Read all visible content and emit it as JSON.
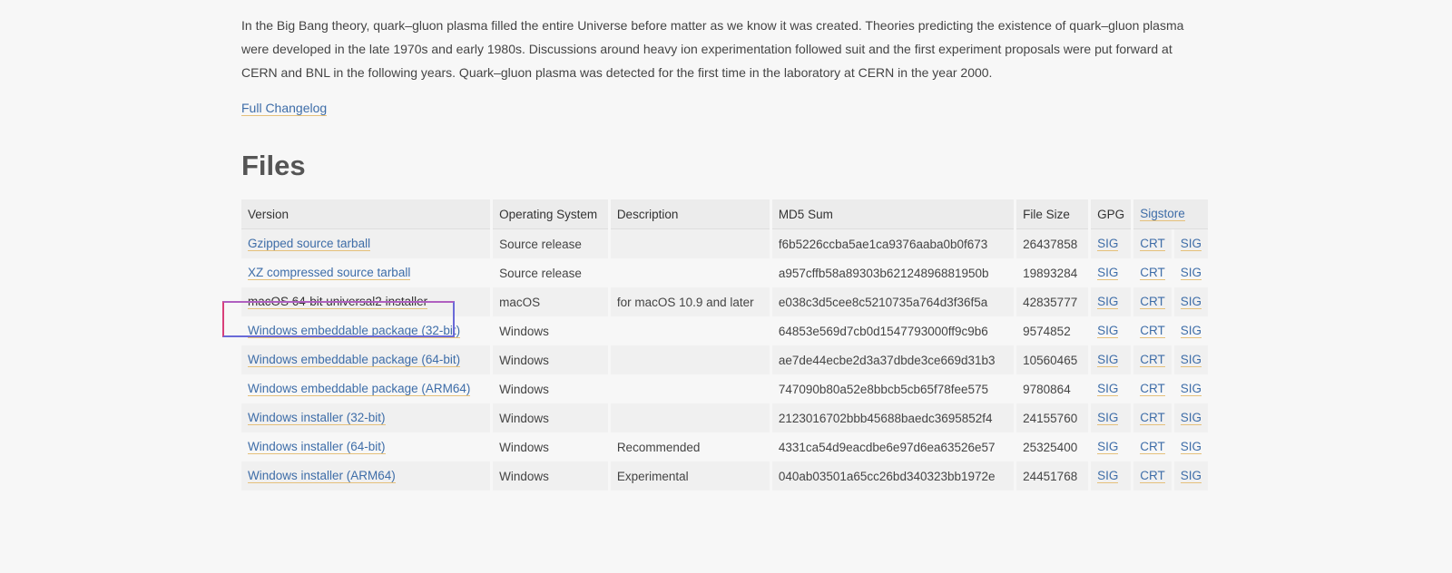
{
  "intro_text": "In the Big Bang theory, quark–gluon plasma filled the entire Universe before matter as we know it was created. Theories predicting the existence of quark–gluon plasma were developed in the late 1970s and early 1980s. Discussions around heavy ion experimentation followed suit and the first experiment proposals were put forward at CERN and BNL in the following years. Quark–gluon plasma was detected for the first time in the laboratory at CERN in the year 2000.",
  "changelog_label": "Full Changelog",
  "files_title": "Files",
  "columns": {
    "version": "Version",
    "os": "Operating System",
    "description": "Description",
    "md5": "MD5 Sum",
    "size": "File Size",
    "gpg": "GPG",
    "sigstore": "Sigstore"
  },
  "rows": [
    {
      "version": "Gzipped source tarball",
      "os": "Source release",
      "description": "",
      "md5": "f6b5226ccba5ae1ca9376aaba0b0f673",
      "size": "26437858",
      "gpg": "SIG",
      "crt": "CRT",
      "sig": "SIG"
    },
    {
      "version": "XZ compressed source tarball",
      "os": "Source release",
      "description": "",
      "md5": "a957cffb58a89303b62124896881950b",
      "size": "19893284",
      "gpg": "SIG",
      "crt": "CRT",
      "sig": "SIG"
    },
    {
      "version": "macOS 64-bit universal2 installer",
      "os": "macOS",
      "description": "for macOS 10.9 and later",
      "md5": "e038c3d5cee8c5210735a764d3f36f5a",
      "size": "42835777",
      "gpg": "SIG",
      "crt": "CRT",
      "sig": "SIG"
    },
    {
      "version": "Windows embeddable package (32-bit)",
      "os": "Windows",
      "description": "",
      "md5": "64853e569d7cb0d1547793000ff9c9b6",
      "size": "9574852",
      "gpg": "SIG",
      "crt": "CRT",
      "sig": "SIG"
    },
    {
      "version": "Windows embeddable package (64-bit)",
      "os": "Windows",
      "description": "",
      "md5": "ae7de44ecbe2d3a37dbde3ce669d31b3",
      "size": "10560465",
      "gpg": "SIG",
      "crt": "CRT",
      "sig": "SIG"
    },
    {
      "version": "Windows embeddable package (ARM64)",
      "os": "Windows",
      "description": "",
      "md5": "747090b80a52e8bbcb5cb65f78fee575",
      "size": "9780864",
      "gpg": "SIG",
      "crt": "CRT",
      "sig": "SIG"
    },
    {
      "version": "Windows installer (32-bit)",
      "os": "Windows",
      "description": "",
      "md5": "2123016702bbb45688baedc3695852f4",
      "size": "24155760",
      "gpg": "SIG",
      "crt": "CRT",
      "sig": "SIG"
    },
    {
      "version": "Windows installer (64-bit)",
      "os": "Windows",
      "description": "Recommended",
      "md5": "4331ca54d9eacdbe6e97d6ea63526e57",
      "size": "25325400",
      "gpg": "SIG",
      "crt": "CRT",
      "sig": "SIG"
    },
    {
      "version": "Windows installer (ARM64)",
      "os": "Windows",
      "description": "Experimental",
      "md5": "040ab03501a65cc26bd340323bb1972e",
      "size": "24451768",
      "gpg": "SIG",
      "crt": "CRT",
      "sig": "SIG"
    }
  ],
  "highlighted_row": 2,
  "colors": {
    "link": "#3e6da8",
    "link_underline": "#e5c07a",
    "highlight_border": "#6a6ad8"
  }
}
